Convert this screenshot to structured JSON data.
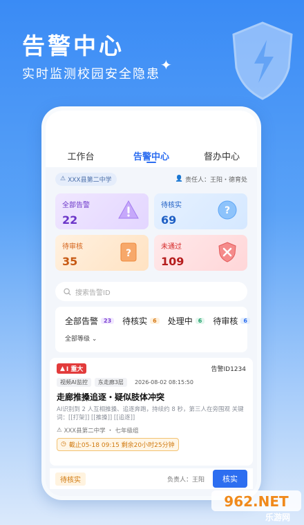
{
  "hero": {
    "title": "告警中心",
    "subtitle": "实时监测校园安全隐患"
  },
  "tabs": [
    {
      "label": "工作台"
    },
    {
      "label": "告警中心",
      "active": true
    },
    {
      "label": "督办中心"
    }
  ],
  "info": {
    "school": "XXX县第二中学",
    "owner": "责任人：王阳・德育处"
  },
  "cards": {
    "all": {
      "label": "全部告警",
      "value": "22"
    },
    "pending_verify": {
      "label": "待核实",
      "value": "69"
    },
    "pending_review": {
      "label": "待审核",
      "value": "35"
    },
    "rejected": {
      "label": "未通过",
      "value": "109"
    }
  },
  "search": {
    "placeholder": "搜索告警ID"
  },
  "filters": [
    {
      "label": "全部告警",
      "count": "23"
    },
    {
      "label": "待核实",
      "count": "6"
    },
    {
      "label": "处理中",
      "count": "6"
    },
    {
      "label": "待审核",
      "count": "6"
    }
  ],
  "level_filter": "全部等级",
  "alert": {
    "severity": "I 重大",
    "id": "告警ID1234",
    "source_tag": "视频AI监控",
    "location_tag": "东走廊3层",
    "time": "2026-08-02 08:15:50",
    "title": "走廊推搡追逐・疑似肢体冲突",
    "description": "AI识别到 2 人互相推搡、追逐奔跑，持续约 8 秒，第三人在旁围观 关键词：[[打架]] [[推搡]] [[追逐]]",
    "location": "XXX县第二中学 ・ 七年级组",
    "deadline": "截止05-18  09:15  剩余20小时25分钟",
    "status": "待核实",
    "responsible": "负责人：王阳",
    "action_label": "核实"
  },
  "watermark": {
    "text": "962.NET",
    "sub": "乐游网"
  },
  "colors": {
    "primary": "#2d6ef0",
    "danger": "#e23b3b",
    "warning": "#d07a10"
  }
}
